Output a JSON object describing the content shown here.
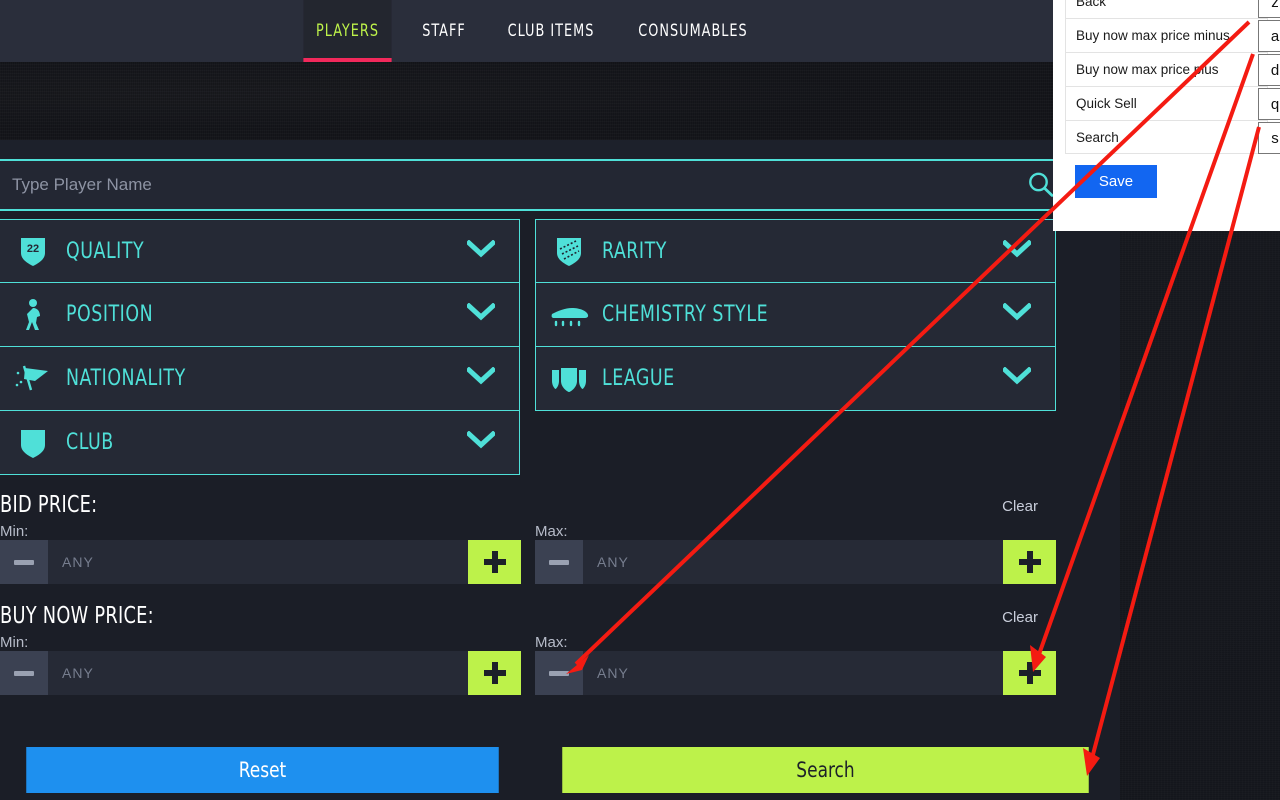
{
  "tabs": [
    {
      "label": "PLAYERS",
      "active": true
    },
    {
      "label": "STAFF",
      "active": false
    },
    {
      "label": "CLUB ITEMS",
      "active": false
    },
    {
      "label": "CONSUMABLES",
      "active": false
    }
  ],
  "search": {
    "placeholder": "Type Player Name",
    "value": "",
    "icon": "search-icon"
  },
  "filters": {
    "left": [
      {
        "label": "QUALITY",
        "icon": "shield-22-icon"
      },
      {
        "label": "POSITION",
        "icon": "player-silhouette-icon"
      },
      {
        "label": "NATIONALITY",
        "icon": "flag-icon"
      },
      {
        "label": "CLUB",
        "icon": "shield-icon"
      }
    ],
    "right": [
      {
        "label": "RARITY",
        "icon": "rarity-shield-icon"
      },
      {
        "label": "CHEMISTRY STYLE",
        "icon": "boot-icon"
      },
      {
        "label": "LEAGUE",
        "icon": "league-icon"
      }
    ],
    "chevron_icon": "chevron-down-icon"
  },
  "bid_price": {
    "title": "BID PRICE:",
    "clear_label": "Clear",
    "min_label": "Min:",
    "max_label": "Max:",
    "min_value": "",
    "max_value": "",
    "min_placeholder": "ANY",
    "max_placeholder": "ANY",
    "minus_icon": "minus-icon",
    "plus_icon": "plus-icon"
  },
  "buy_now_price": {
    "title": "BUY NOW PRICE:",
    "clear_label": "Clear",
    "min_label": "Min:",
    "max_label": "Max:",
    "min_value": "",
    "max_value": "",
    "min_placeholder": "ANY",
    "max_placeholder": "ANY",
    "minus_icon": "minus-icon",
    "plus_icon": "plus-icon"
  },
  "actions": {
    "reset_label": "Reset",
    "search_label": "Search"
  },
  "shortcut_panel": {
    "rows": [
      {
        "name": "Back",
        "key": "z"
      },
      {
        "name": "Buy now max price minus",
        "key": "a"
      },
      {
        "name": "Buy now max price plus",
        "key": "d"
      },
      {
        "name": "Quick Sell",
        "key": "q"
      },
      {
        "name": "Search",
        "key": "s"
      }
    ],
    "save_label": "Save"
  },
  "colors": {
    "accent_cyan": "#4fe0d8",
    "accent_green": "#bdf24a",
    "accent_pink": "#f2295b",
    "accent_blue": "#1e90ef",
    "panel_bg": "#1b1e27",
    "row_bg": "#252935",
    "save_blue": "#1266f1",
    "annotation_red": "#f41b12"
  },
  "annotations": [
    {
      "from_key": "a",
      "to": "buy-now-max-minus-button"
    },
    {
      "from_key": "d",
      "to": "buy-now-max-plus-button"
    },
    {
      "from_key": "s",
      "to": "search-button"
    }
  ]
}
